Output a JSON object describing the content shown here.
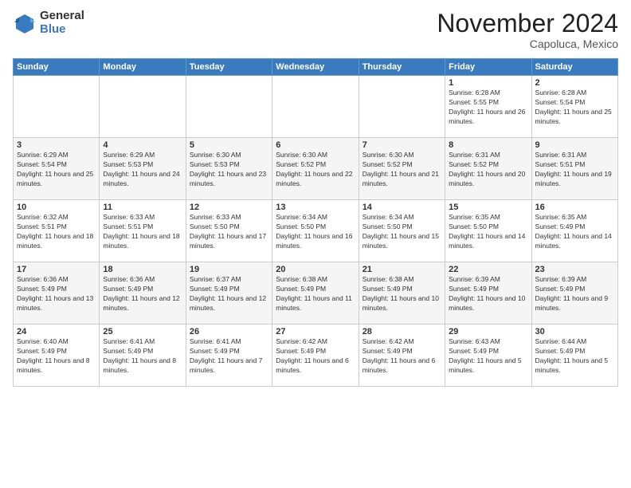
{
  "logo": {
    "general": "General",
    "blue": "Blue"
  },
  "title": "November 2024",
  "location": "Capoluca, Mexico",
  "weekdays": [
    "Sunday",
    "Monday",
    "Tuesday",
    "Wednesday",
    "Thursday",
    "Friday",
    "Saturday"
  ],
  "weeks": [
    [
      {
        "day": "",
        "info": ""
      },
      {
        "day": "",
        "info": ""
      },
      {
        "day": "",
        "info": ""
      },
      {
        "day": "",
        "info": ""
      },
      {
        "day": "",
        "info": ""
      },
      {
        "day": "1",
        "info": "Sunrise: 6:28 AM\nSunset: 5:55 PM\nDaylight: 11 hours and 26 minutes."
      },
      {
        "day": "2",
        "info": "Sunrise: 6:28 AM\nSunset: 5:54 PM\nDaylight: 11 hours and 25 minutes."
      }
    ],
    [
      {
        "day": "3",
        "info": "Sunrise: 6:29 AM\nSunset: 5:54 PM\nDaylight: 11 hours and 25 minutes."
      },
      {
        "day": "4",
        "info": "Sunrise: 6:29 AM\nSunset: 5:53 PM\nDaylight: 11 hours and 24 minutes."
      },
      {
        "day": "5",
        "info": "Sunrise: 6:30 AM\nSunset: 5:53 PM\nDaylight: 11 hours and 23 minutes."
      },
      {
        "day": "6",
        "info": "Sunrise: 6:30 AM\nSunset: 5:52 PM\nDaylight: 11 hours and 22 minutes."
      },
      {
        "day": "7",
        "info": "Sunrise: 6:30 AM\nSunset: 5:52 PM\nDaylight: 11 hours and 21 minutes."
      },
      {
        "day": "8",
        "info": "Sunrise: 6:31 AM\nSunset: 5:52 PM\nDaylight: 11 hours and 20 minutes."
      },
      {
        "day": "9",
        "info": "Sunrise: 6:31 AM\nSunset: 5:51 PM\nDaylight: 11 hours and 19 minutes."
      }
    ],
    [
      {
        "day": "10",
        "info": "Sunrise: 6:32 AM\nSunset: 5:51 PM\nDaylight: 11 hours and 18 minutes."
      },
      {
        "day": "11",
        "info": "Sunrise: 6:33 AM\nSunset: 5:51 PM\nDaylight: 11 hours and 18 minutes."
      },
      {
        "day": "12",
        "info": "Sunrise: 6:33 AM\nSunset: 5:50 PM\nDaylight: 11 hours and 17 minutes."
      },
      {
        "day": "13",
        "info": "Sunrise: 6:34 AM\nSunset: 5:50 PM\nDaylight: 11 hours and 16 minutes."
      },
      {
        "day": "14",
        "info": "Sunrise: 6:34 AM\nSunset: 5:50 PM\nDaylight: 11 hours and 15 minutes."
      },
      {
        "day": "15",
        "info": "Sunrise: 6:35 AM\nSunset: 5:50 PM\nDaylight: 11 hours and 14 minutes."
      },
      {
        "day": "16",
        "info": "Sunrise: 6:35 AM\nSunset: 5:49 PM\nDaylight: 11 hours and 14 minutes."
      }
    ],
    [
      {
        "day": "17",
        "info": "Sunrise: 6:36 AM\nSunset: 5:49 PM\nDaylight: 11 hours and 13 minutes."
      },
      {
        "day": "18",
        "info": "Sunrise: 6:36 AM\nSunset: 5:49 PM\nDaylight: 11 hours and 12 minutes."
      },
      {
        "day": "19",
        "info": "Sunrise: 6:37 AM\nSunset: 5:49 PM\nDaylight: 11 hours and 12 minutes."
      },
      {
        "day": "20",
        "info": "Sunrise: 6:38 AM\nSunset: 5:49 PM\nDaylight: 11 hours and 11 minutes."
      },
      {
        "day": "21",
        "info": "Sunrise: 6:38 AM\nSunset: 5:49 PM\nDaylight: 11 hours and 10 minutes."
      },
      {
        "day": "22",
        "info": "Sunrise: 6:39 AM\nSunset: 5:49 PM\nDaylight: 11 hours and 10 minutes."
      },
      {
        "day": "23",
        "info": "Sunrise: 6:39 AM\nSunset: 5:49 PM\nDaylight: 11 hours and 9 minutes."
      }
    ],
    [
      {
        "day": "24",
        "info": "Sunrise: 6:40 AM\nSunset: 5:49 PM\nDaylight: 11 hours and 8 minutes."
      },
      {
        "day": "25",
        "info": "Sunrise: 6:41 AM\nSunset: 5:49 PM\nDaylight: 11 hours and 8 minutes."
      },
      {
        "day": "26",
        "info": "Sunrise: 6:41 AM\nSunset: 5:49 PM\nDaylight: 11 hours and 7 minutes."
      },
      {
        "day": "27",
        "info": "Sunrise: 6:42 AM\nSunset: 5:49 PM\nDaylight: 11 hours and 6 minutes."
      },
      {
        "day": "28",
        "info": "Sunrise: 6:42 AM\nSunset: 5:49 PM\nDaylight: 11 hours and 6 minutes."
      },
      {
        "day": "29",
        "info": "Sunrise: 6:43 AM\nSunset: 5:49 PM\nDaylight: 11 hours and 5 minutes."
      },
      {
        "day": "30",
        "info": "Sunrise: 6:44 AM\nSunset: 5:49 PM\nDaylight: 11 hours and 5 minutes."
      }
    ]
  ]
}
